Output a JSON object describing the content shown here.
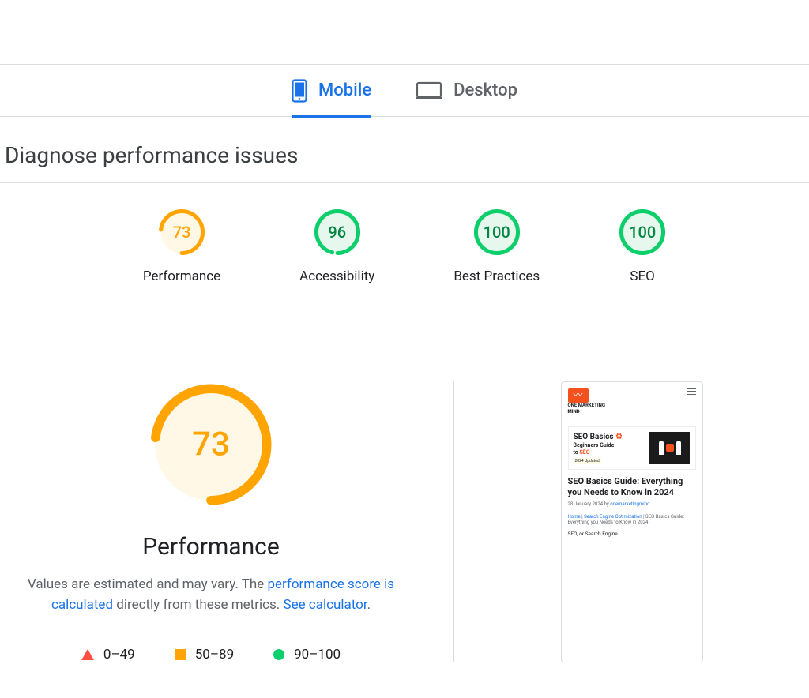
{
  "tabs": {
    "mobile": "Mobile",
    "desktop": "Desktop"
  },
  "diagnose": {
    "title": "Diagnose performance issues"
  },
  "colors": {
    "avg_stroke": "#ffa400",
    "avg_fill": "#fff8e6",
    "good_stroke": "#0cce6b",
    "good_fill": "#e6f7ed",
    "good_text": "#018642"
  },
  "metrics": [
    {
      "label": "Performance",
      "value": 73,
      "tier": "avg"
    },
    {
      "label": "Accessibility",
      "value": 96,
      "tier": "good"
    },
    {
      "label": "Best Practices",
      "value": 100,
      "tier": "good"
    },
    {
      "label": "SEO",
      "value": 100,
      "tier": "good"
    }
  ],
  "perf": {
    "value": 73,
    "tier": "avg",
    "label": "Performance",
    "desc_a": "Values are estimated and may vary. The ",
    "desc_link1": "performance score is calculated",
    "desc_b": " directly from these metrics. ",
    "desc_link2": "See calculator"
  },
  "legend": {
    "a": "0–49",
    "b": "50–89",
    "c": "90–100"
  },
  "preview": {
    "logo_text_top": "ONE MARKETING",
    "logo_text_bot": "MIND",
    "hero_title": "SEO Basics",
    "hero_sub_a": "Beginners Guide",
    "hero_sub_b": "to ",
    "hero_sub_seo": "SEO",
    "hero_updated": "2024 Updated",
    "post_title": "SEO Basics Guide: Everything you Needs to Know in 2024",
    "meta_date": "28 January 2024 by ",
    "meta_author": "onemarketingmind",
    "bc_home": "Home",
    "bc_sep": " | ",
    "bc_seo": "Search Engine Optimization",
    "bc_tail": " | SEO Basics Guide: Everything you Needs to Know in 2024",
    "excerpt": "SEO, or Search Engine"
  }
}
